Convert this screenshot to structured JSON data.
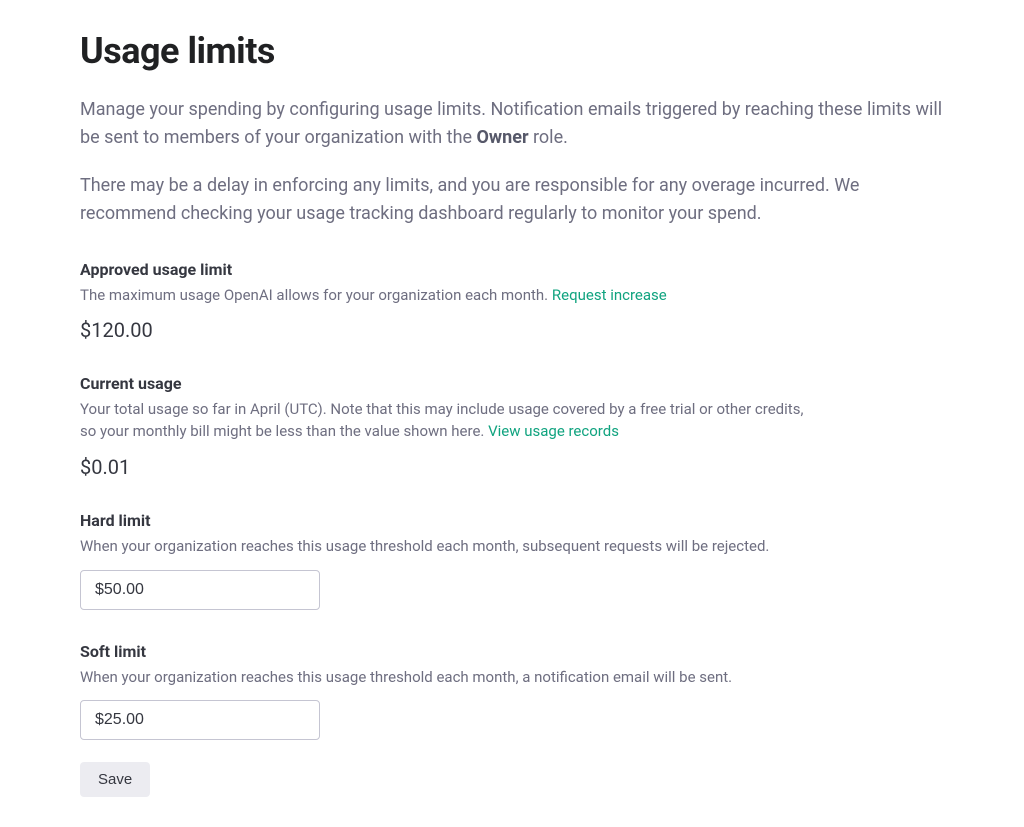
{
  "page_title": "Usage limits",
  "intro": {
    "part1_before": "Manage your spending by configuring usage limits. Notification emails triggered by reaching these limits will be sent to members of your organization with the ",
    "owner_word": "Owner",
    "part1_after": " role.",
    "part2": "There may be a delay in enforcing any limits, and you are responsible for any overage incurred. We recommend checking your usage tracking dashboard regularly to monitor your spend."
  },
  "approved": {
    "title": "Approved usage limit",
    "desc": "The maximum usage OpenAI allows for your organization each month. ",
    "link": "Request increase",
    "value": "$120.00"
  },
  "current": {
    "title": "Current usage",
    "desc_line1": "Your total usage so far in April (UTC). Note that this may include usage covered by a free trial or other credits,",
    "desc_line2": "so your monthly bill might be less than the value shown here. ",
    "link": "View usage records",
    "value": "$0.01"
  },
  "hard": {
    "title": "Hard limit",
    "desc": "When your organization reaches this usage threshold each month, subsequent requests will be rejected.",
    "input_value": "$50.00"
  },
  "soft": {
    "title": "Soft limit",
    "desc": "When your organization reaches this usage threshold each month, a notification email will be sent.",
    "input_value": "$25.00"
  },
  "save_button": "Save"
}
